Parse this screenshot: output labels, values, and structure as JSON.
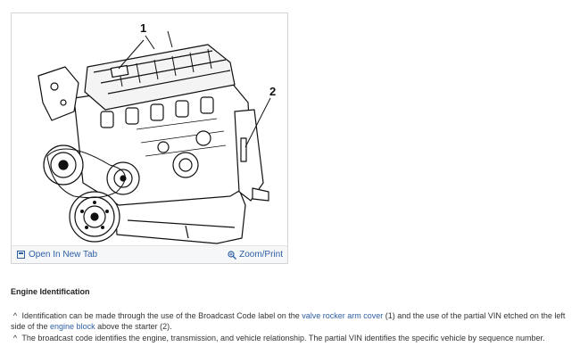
{
  "figure": {
    "callouts": [
      "1",
      "2"
    ],
    "open_tab_label": "Open In New Tab",
    "zoom_label": "Zoom/Print",
    "open_tab_icon": "open-in-new-tab-icon",
    "zoom_icon": "magnifier-zoom-icon"
  },
  "section": {
    "title": "Engine Identification"
  },
  "bullets": [
    {
      "mark": "^",
      "parts": [
        {
          "text": "Identification can be made through the use of the Broadcast Code label on the ",
          "link": false
        },
        {
          "text": "valve rocker arm cover",
          "link": true
        },
        {
          "text": " (1) and the use of the partial VIN etched on the left side of the ",
          "link": false
        },
        {
          "text": "engine block",
          "link": true
        },
        {
          "text": " above the starter (2).",
          "link": false
        }
      ]
    },
    {
      "mark": "^",
      "parts": [
        {
          "text": "The broadcast code identifies the engine, transmission, and vehicle relationship. The partial VIN identifies the specific vehicle by sequence number.",
          "link": false
        }
      ]
    }
  ],
  "colors": {
    "link": "#2f5fa5",
    "border": "#d4d4d4",
    "footer_bg": "#f6f7f9"
  }
}
